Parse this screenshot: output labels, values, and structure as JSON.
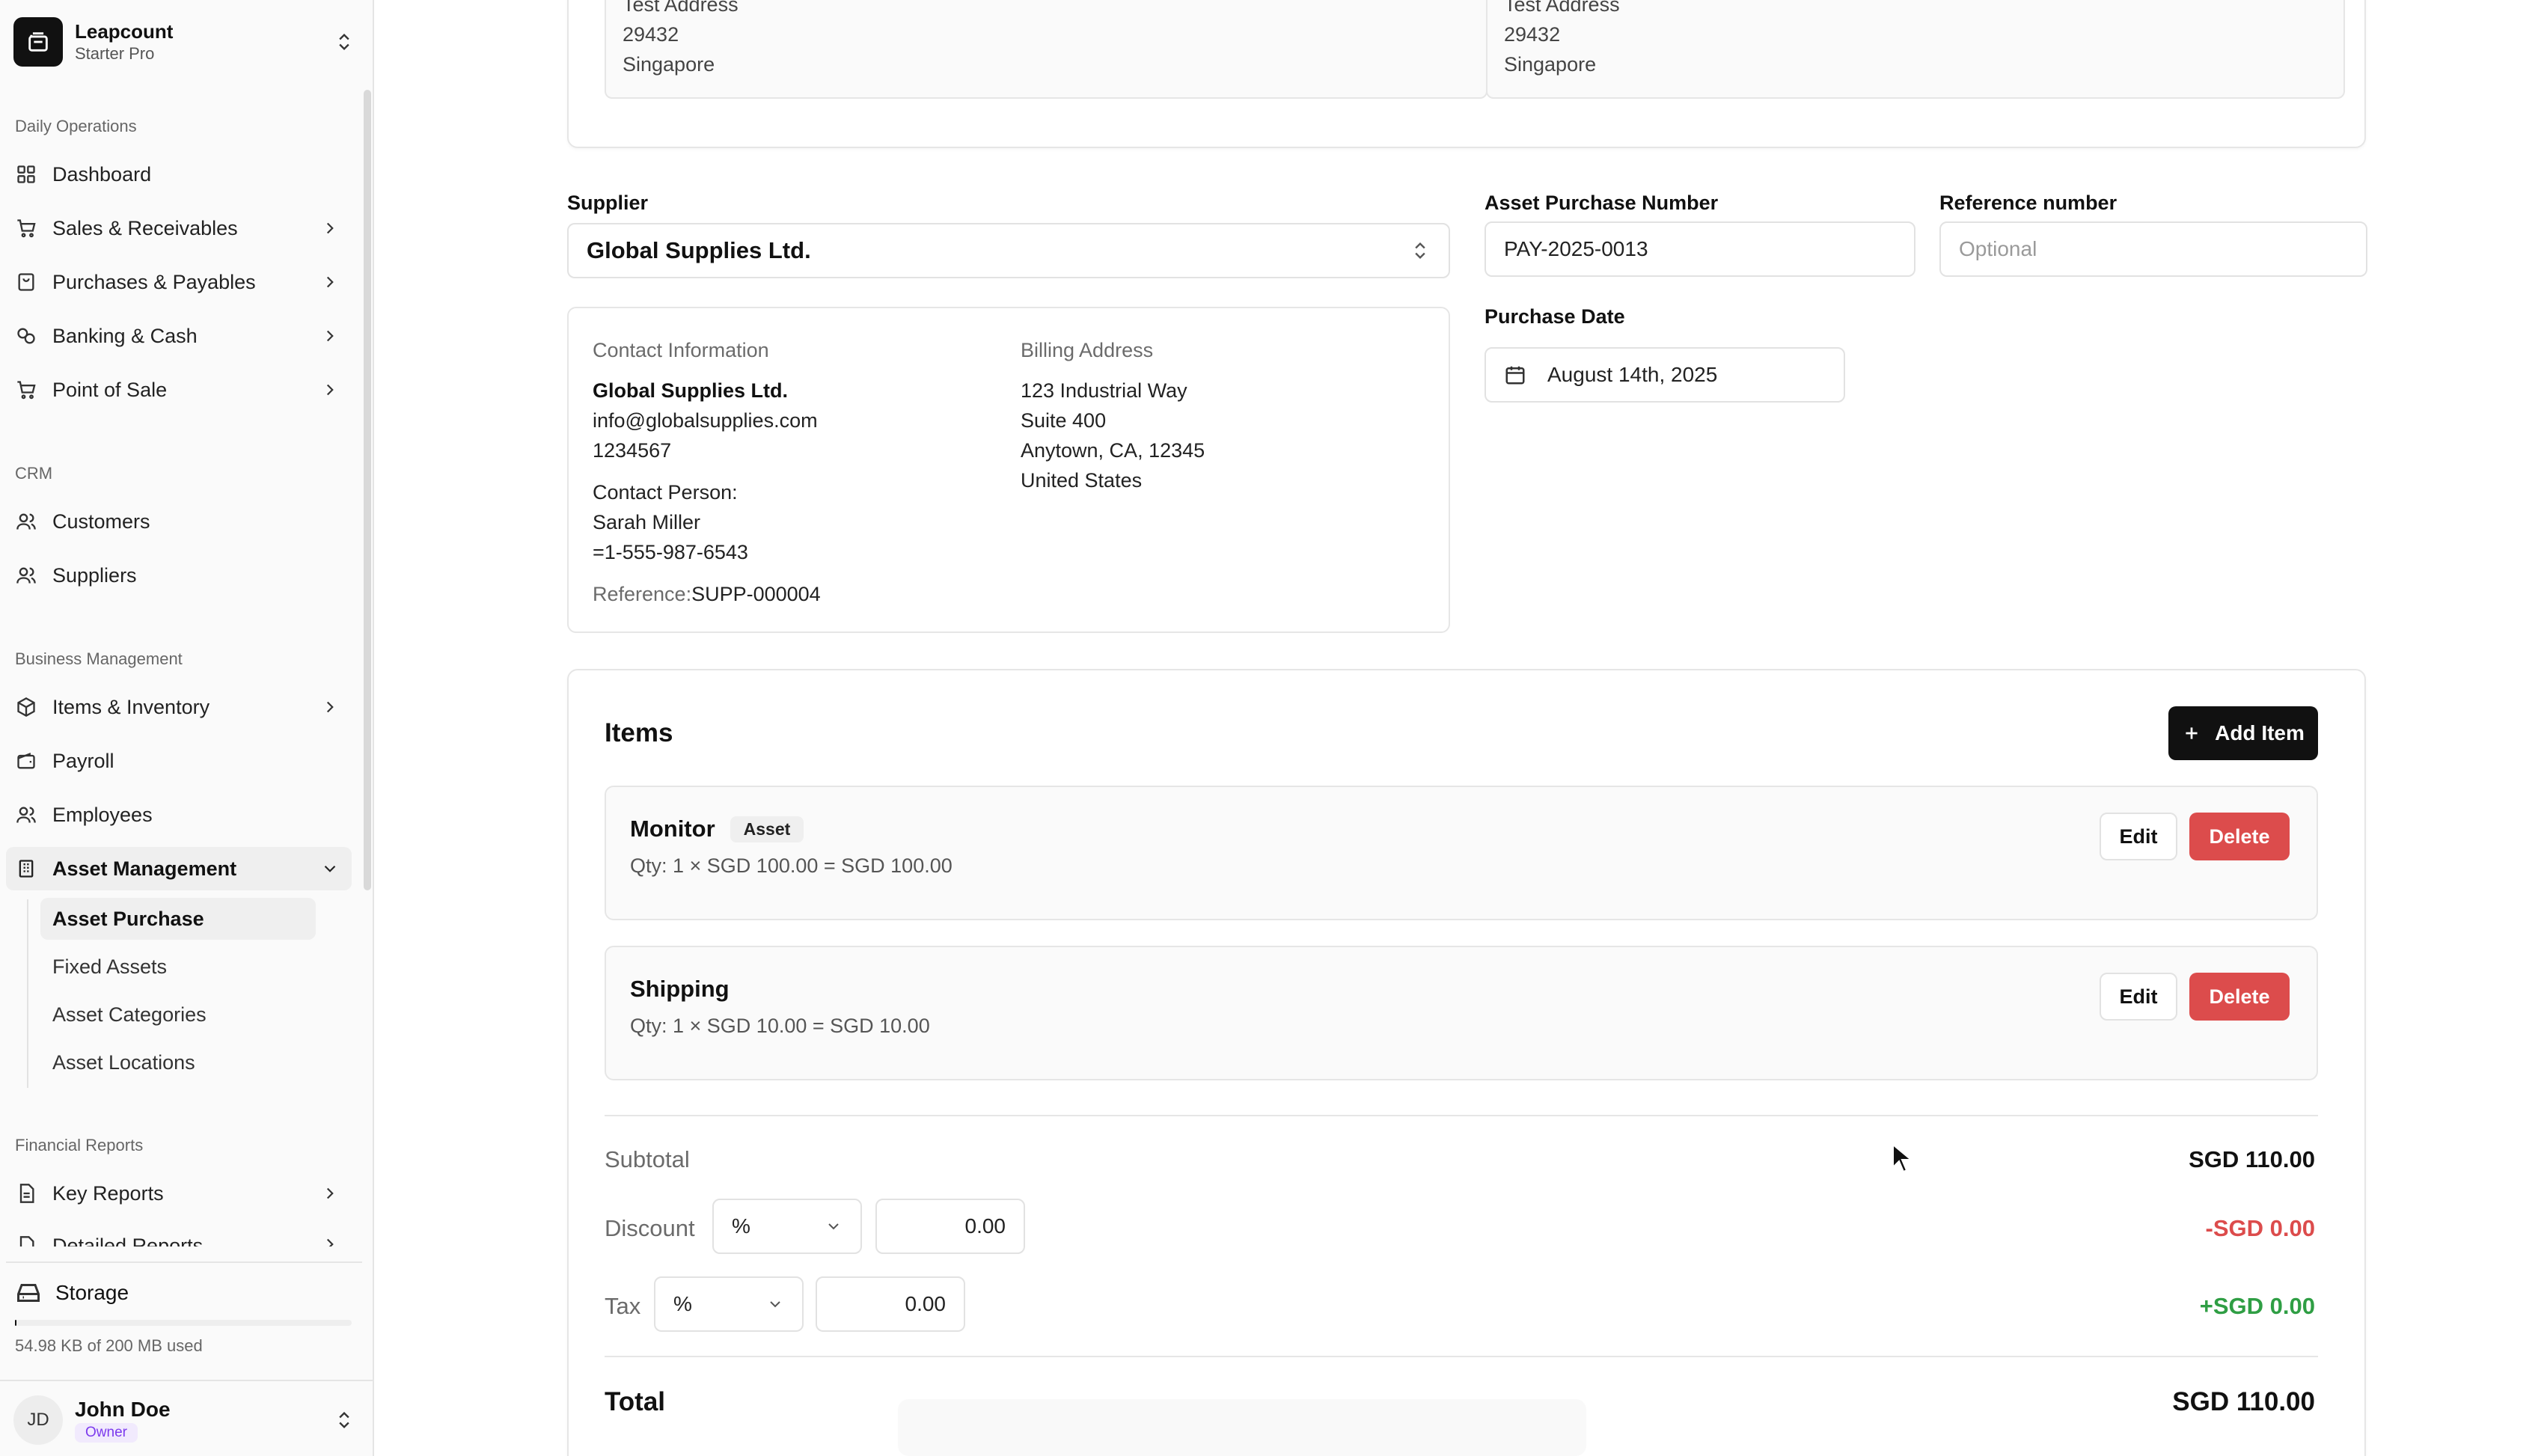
{
  "workspace": {
    "name": "Leapcount",
    "plan": "Starter Pro"
  },
  "sidebar": {
    "sections": {
      "daily": "Daily Operations",
      "crm": "CRM",
      "business": "Business Management",
      "reports": "Financial Reports"
    },
    "items": {
      "dashboard": "Dashboard",
      "sales": "Sales & Receivables",
      "purchases": "Purchases & Payables",
      "banking": "Banking & Cash",
      "pos": "Point of Sale",
      "customers": "Customers",
      "suppliers": "Suppliers",
      "items_inventory": "Items & Inventory",
      "payroll": "Payroll",
      "employees": "Employees",
      "asset_management": "Asset Management",
      "key_reports": "Key Reports",
      "detailed_reports": "Detailed Reports"
    },
    "asset_sub": [
      "Asset Purchase",
      "Fixed Assets",
      "Asset Categories",
      "Asset Locations"
    ]
  },
  "storage": {
    "title": "Storage",
    "usage": "54.98 KB of 200 MB used",
    "fraction": 0.0003
  },
  "user": {
    "name": "John Doe",
    "initials": "JD",
    "role": "Owner"
  },
  "addresses": {
    "left": [
      "Test Address",
      "29432",
      "Singapore"
    ],
    "right": [
      "Test Address",
      "29432",
      "Singapore"
    ]
  },
  "form": {
    "supplier_label": "Supplier",
    "supplier_value": "Global Supplies Ltd.",
    "purchase_number_label": "Asset Purchase Number",
    "purchase_number_value": "PAY-2025-0013",
    "reference_label": "Reference number",
    "reference_placeholder": "Optional",
    "date_label": "Purchase Date",
    "date_value": "August 14th, 2025"
  },
  "supplier_info": {
    "contact_heading": "Contact Information",
    "name": "Global Supplies Ltd.",
    "email": "info@globalsupplies.com",
    "phone": "1234567",
    "contact_person_label": "Contact Person:",
    "contact_person": "Sarah Miller",
    "contact_phone": "=1-555-987-6543",
    "reference_label": "Reference:",
    "reference_value": "SUPP-000004",
    "billing_heading": "Billing Address",
    "billing_lines": [
      "123 Industrial Way",
      "Suite 400",
      "Anytown, CA, 12345",
      "United States"
    ]
  },
  "items": {
    "title": "Items",
    "add_label": "Add Item",
    "edit_label": "Edit",
    "delete_label": "Delete",
    "rows": [
      {
        "name": "Monitor",
        "badge": "Asset",
        "calc": "Qty: 1 × SGD 100.00 = SGD 100.00"
      },
      {
        "name": "Shipping",
        "badge": "",
        "calc": "Qty: 1 × SGD 10.00 = SGD 10.00"
      }
    ]
  },
  "summary": {
    "subtotal_label": "Subtotal",
    "subtotal_value": "SGD 110.00",
    "discount_label": "Discount",
    "discount_type": "%",
    "discount_input": "0.00",
    "discount_value": "-SGD 0.00",
    "tax_label": "Tax",
    "tax_type": "%",
    "tax_input": "0.00",
    "tax_value": "+SGD 0.00",
    "total_label": "Total",
    "total_value": "SGD 110.00"
  },
  "colors": {
    "danger": "#dc4c4c",
    "success": "#2f9e44",
    "primary": "#111111"
  },
  "icons": [
    "layout-grid-icon",
    "cart-icon",
    "receipt-icon",
    "coins-icon",
    "users-icon",
    "package-icon",
    "wallet-icon",
    "building-icon",
    "file-text-icon",
    "hard-drive-icon",
    "calendar-icon",
    "plus-icon",
    "chevron-right-icon",
    "chevron-down-icon",
    "chevrons-up-down-icon"
  ]
}
